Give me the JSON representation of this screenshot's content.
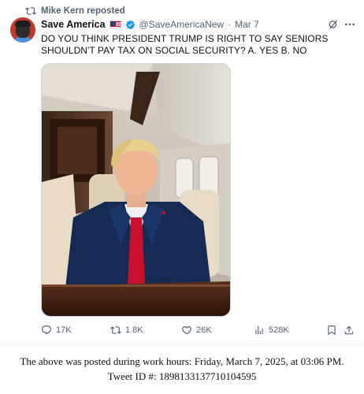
{
  "repost": {
    "label": "Mike Kern reposted"
  },
  "tweet": {
    "display_name": "Save America",
    "handle": "@SaveAmericaNew",
    "separator": "·",
    "date": "Mar 7",
    "text": "DO YOU THINK PRESIDENT TRUMP IS RIGHT TO SAY SENIORS SHOULDN'T PAY TAX ON SOCIAL SECURITY? A. YES B. NO"
  },
  "icons": {
    "repost": "repost-icon",
    "verified": "verified-badge-icon",
    "flag": "us-flag-icon",
    "grok": "grok-icon",
    "more": "more-options-icon",
    "reply": "reply-icon",
    "retweet": "retweet-icon",
    "like": "like-icon",
    "views": "views-icon",
    "bookmark": "bookmark-icon",
    "share": "share-icon"
  },
  "metrics": {
    "replies": "17K",
    "reposts": "1.8K",
    "likes": "26K",
    "views": "528K"
  },
  "colors": {
    "verified_blue": "#1d9bf0",
    "secondary_text": "#536471",
    "primary_text": "#0f1419"
  },
  "caption": {
    "line1": "The above was posted during work hours: Friday, March 7, 2025, at 03:06 PM.",
    "line2": "Tweet ID #: 1898133137710104595"
  }
}
